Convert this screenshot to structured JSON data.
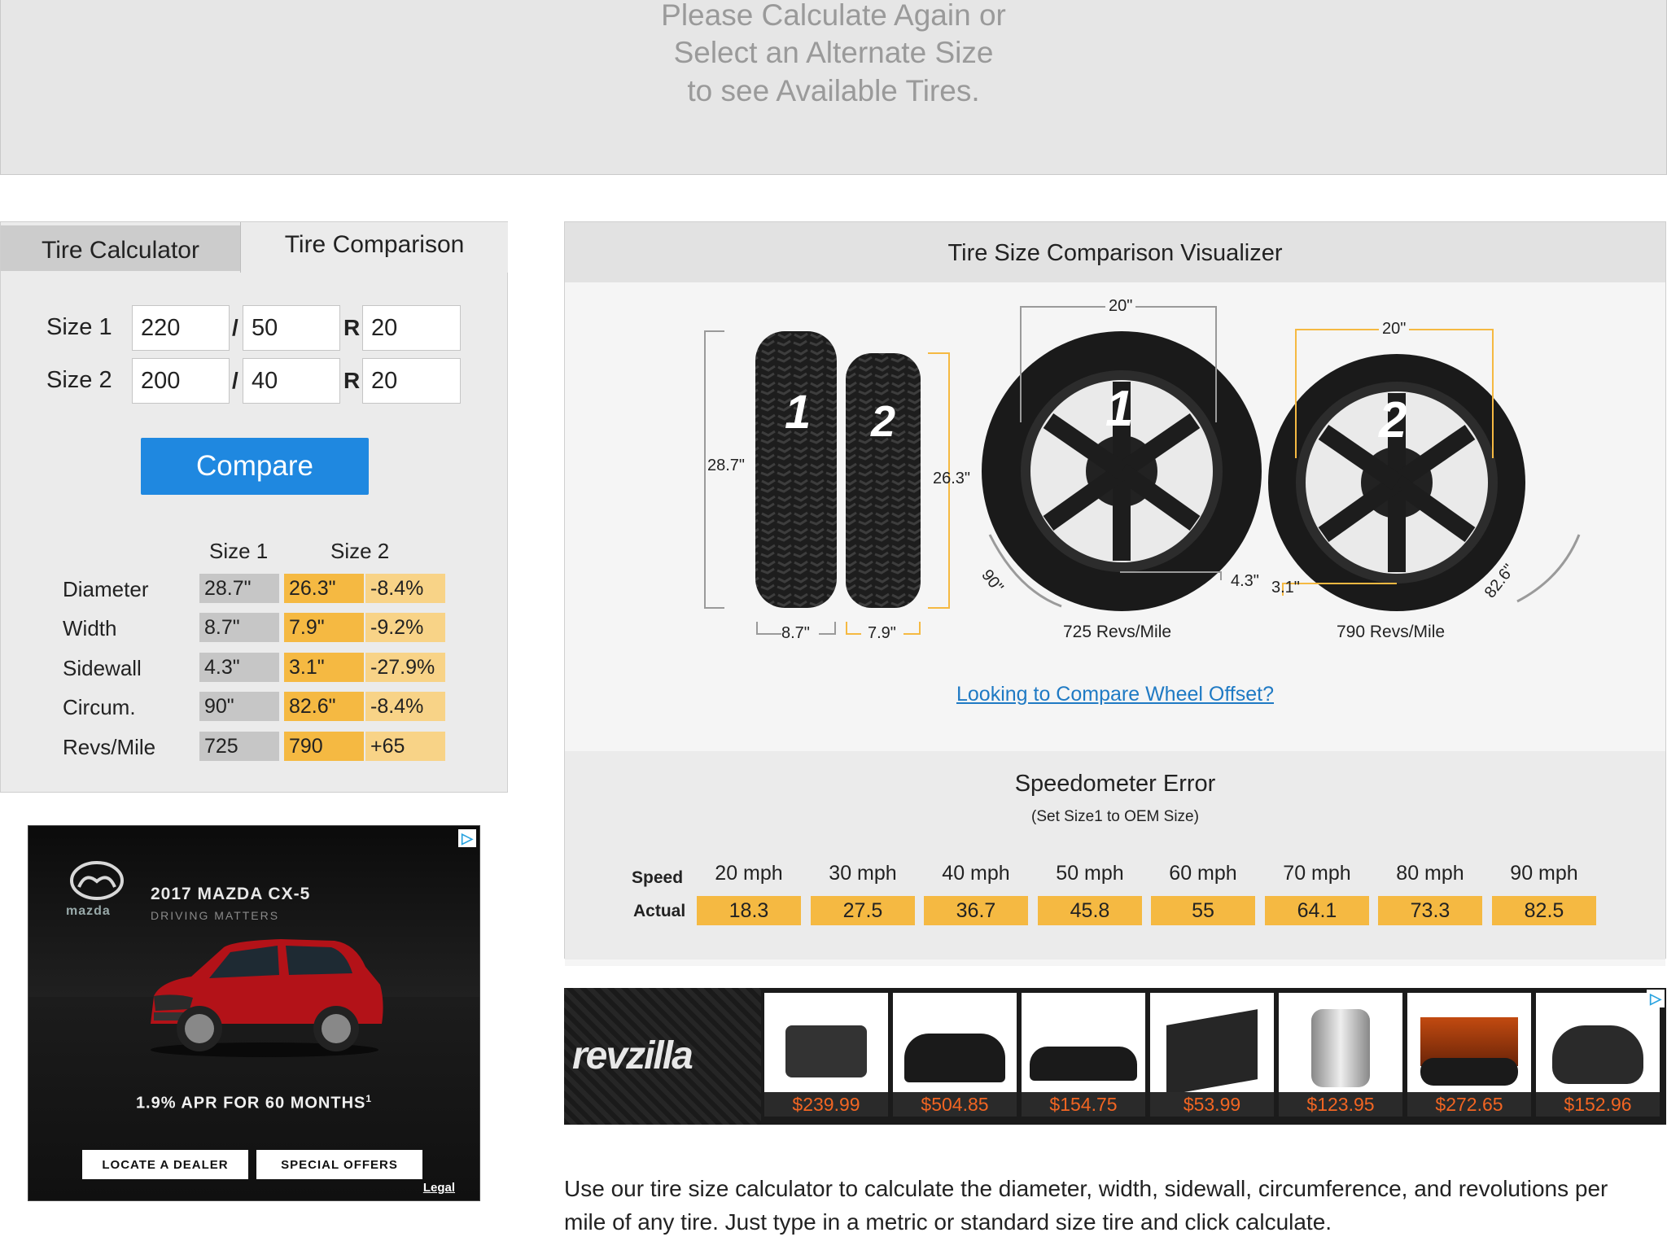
{
  "banner": {
    "line1": "Please Calculate Again or",
    "line2": "Select an Alternate Size",
    "line3": "to see Available Tires."
  },
  "tabs": {
    "calculator": "Tire Calculator",
    "comparison": "Tire Comparison"
  },
  "form": {
    "size1_label": "Size 1",
    "size2_label": "Size 2",
    "slash": "/",
    "r": "R",
    "size1": {
      "width": "220",
      "aspect": "50",
      "rim": "20"
    },
    "size2": {
      "width": "200",
      "aspect": "40",
      "rim": "20"
    },
    "compare_label": "Compare"
  },
  "results": {
    "header_size1": "Size 1",
    "header_size2": "Size 2",
    "rows": [
      {
        "label": "Diameter",
        "s1": "28.7\"",
        "s2": "26.3\"",
        "diff": "-8.4%"
      },
      {
        "label": "Width",
        "s1": "8.7\"",
        "s2": "7.9\"",
        "diff": "-9.2%"
      },
      {
        "label": "Sidewall",
        "s1": "4.3\"",
        "s2": "3.1\"",
        "diff": "-27.9%"
      },
      {
        "label": "Circum.",
        "s1": "90\"",
        "s2": "82.6\"",
        "diff": "-8.4%"
      },
      {
        "label": "Revs/Mile",
        "s1": "725",
        "s2": "790",
        "diff": "+65"
      }
    ]
  },
  "mazda_ad": {
    "brand": "mazda",
    "model": "2017 MAZDA CX-5",
    "tagline": "DRIVING MATTERS",
    "offer": "1.9% APR FOR 60 MONTHS",
    "offer_sup": "1",
    "locate": "LOCATE A DEALER",
    "special": "SPECIAL OFFERS",
    "legal": "Legal"
  },
  "visualizer": {
    "title": "Tire Size Comparison Visualizer",
    "tire1_label": "1",
    "tire2_label": "2",
    "tire1_diameter": "28.7\"",
    "tire2_diameter": "26.3\"",
    "tire1_width": "8.7\"",
    "tire2_width": "7.9\"",
    "wheel1_rim": "20\"",
    "wheel2_rim": "20\"",
    "wheel1_circ": "90\"",
    "wheel2_circ": "82.6\"",
    "wheel1_sidewall": "4.3\"",
    "wheel2_sidewall": "3.1\"",
    "wheel1_revs": "725 Revs/Mile",
    "wheel2_revs": "790 Revs/Mile",
    "offset_link": "Looking to Compare Wheel Offset?"
  },
  "speedometer": {
    "title": "Speedometer Error",
    "subtitle": "(Set Size1 to OEM Size)",
    "speed_label": "Speed",
    "actual_label": "Actual",
    "speeds": [
      "20 mph",
      "30 mph",
      "40 mph",
      "50 mph",
      "60 mph",
      "70 mph",
      "80 mph",
      "90 mph"
    ],
    "actuals": [
      "18.3",
      "27.5",
      "36.7",
      "45.8",
      "55",
      "64.1",
      "73.3",
      "82.5"
    ]
  },
  "revzilla": {
    "brand": "revzilla",
    "prices": [
      "$239.99",
      "$504.85",
      "$154.75",
      "$53.99",
      "$123.95",
      "$272.65",
      "$152.96"
    ]
  },
  "description": "Use our tire size calculator to calculate the diameter, width, sidewall, circumference, and revolutions per mile of any tire. Just type in a metric or standard size tire and click calculate.",
  "colors": {
    "accent_blue": "#1f88e0",
    "size2_orange": "#f5b942",
    "diff_orange": "#f8d387",
    "size1_gray": "#c6c6c6",
    "revzilla_orange": "#f26522"
  }
}
